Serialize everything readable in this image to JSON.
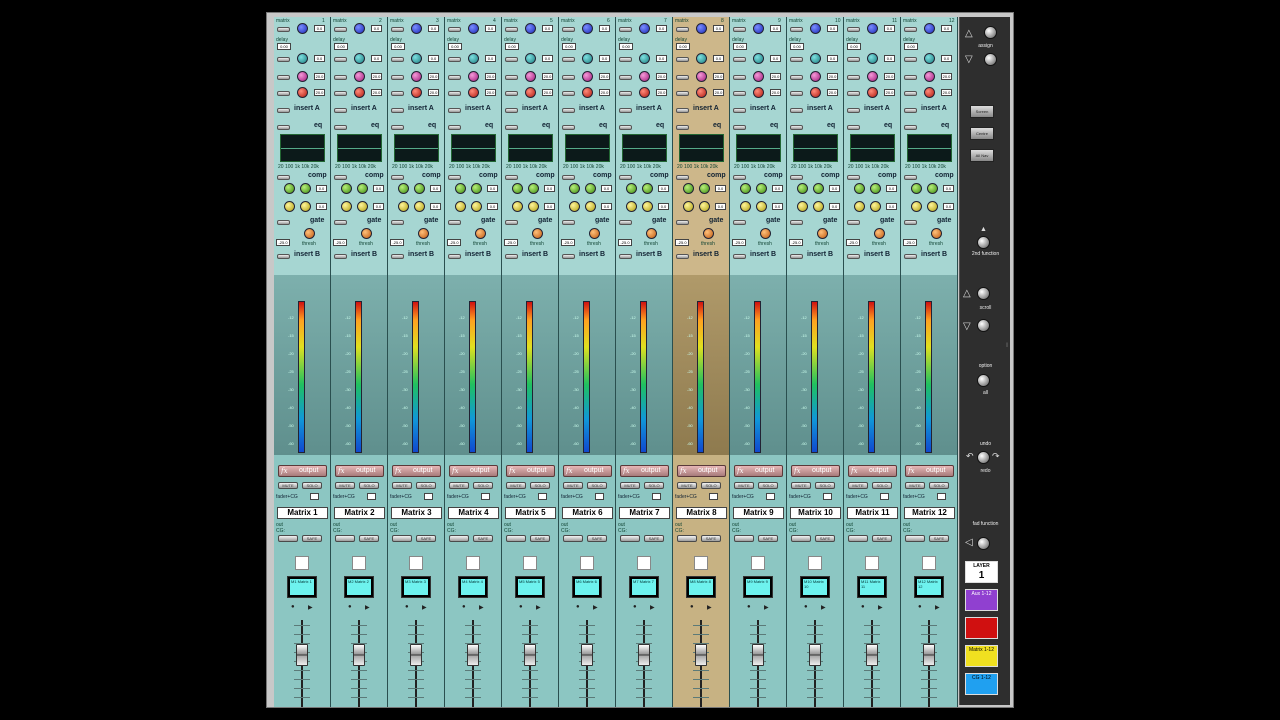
{
  "window": {
    "name": "Matrix Mixer"
  },
  "channel_labels": {
    "matrix": "matrix",
    "delay": "delay",
    "insert_a": "insert A",
    "eq": "eq",
    "comp": "comp",
    "gate": "gate",
    "insert_b": "insert B",
    "thresh": "thresh",
    "output": "output",
    "fx": "fx",
    "mute": "MUTE",
    "fader_cg": "fader+CG",
    "safe": "SAFE",
    "solo": "SOLO",
    "out": "out",
    "cg": "CG:",
    "eq_freqs": "20 100 1k 10k 20k",
    "delay_value": "0.00",
    "gain_value": "0.0",
    "freq_value": "20.0",
    "thresh_value": "-25.0",
    "meter_scale": [
      "-12",
      "-15",
      "-20",
      "-25",
      "-30",
      "-40",
      "-50",
      "-60"
    ]
  },
  "channels": [
    {
      "num": "1",
      "name": "Matrix 1",
      "lcd": "M1 Matrix 1"
    },
    {
      "num": "2",
      "name": "Matrix 2",
      "lcd": "M2 Matrix 2"
    },
    {
      "num": "3",
      "name": "Matrix 3",
      "lcd": "M3 Matrix 3"
    },
    {
      "num": "4",
      "name": "Matrix 4",
      "lcd": "M4 Matrix 4"
    },
    {
      "num": "5",
      "name": "Matrix 5",
      "lcd": "M5 Matrix 5"
    },
    {
      "num": "6",
      "name": "Matrix 6",
      "lcd": "M6 Matrix 6"
    },
    {
      "num": "7",
      "name": "Matrix 7",
      "lcd": "M7 Matrix 7"
    },
    {
      "num": "8",
      "name": "Matrix 8",
      "lcd": "M8 Matrix 8",
      "selected": true
    },
    {
      "num": "9",
      "name": "Matrix 9",
      "lcd": "M9 Matrix 9"
    },
    {
      "num": "10",
      "name": "Matrix 10",
      "lcd": "M10 Matrix 10"
    },
    {
      "num": "11",
      "name": "Matrix 11",
      "lcd": "M11 Matrix 11"
    },
    {
      "num": "12",
      "name": "Matrix 12",
      "lcd": "M12 Matrix 12"
    }
  ],
  "side_panel": {
    "assign": "assign",
    "screen": "Screen",
    "centre": "Centre",
    "all_nav": "All Nav",
    "second_function": "2nd function",
    "scroll": "scroll",
    "option": "option",
    "all": "all",
    "undo": "undo",
    "redo": "redo",
    "fad_function": "fad function",
    "layer_label": "LAYER",
    "layer_value": "1",
    "layer_buttons": [
      "Aux 1-12",
      "",
      "Matrix 1-12",
      "CG 1-12"
    ]
  },
  "colors": {
    "strip_bg": "#a6d6d2",
    "selected_strip_bg": "#cdb78a",
    "layer_aux": "#9040d0",
    "layer_red": "#d01010",
    "layer_matrix": "#f0e020",
    "layer_cg": "#20a0f0"
  }
}
